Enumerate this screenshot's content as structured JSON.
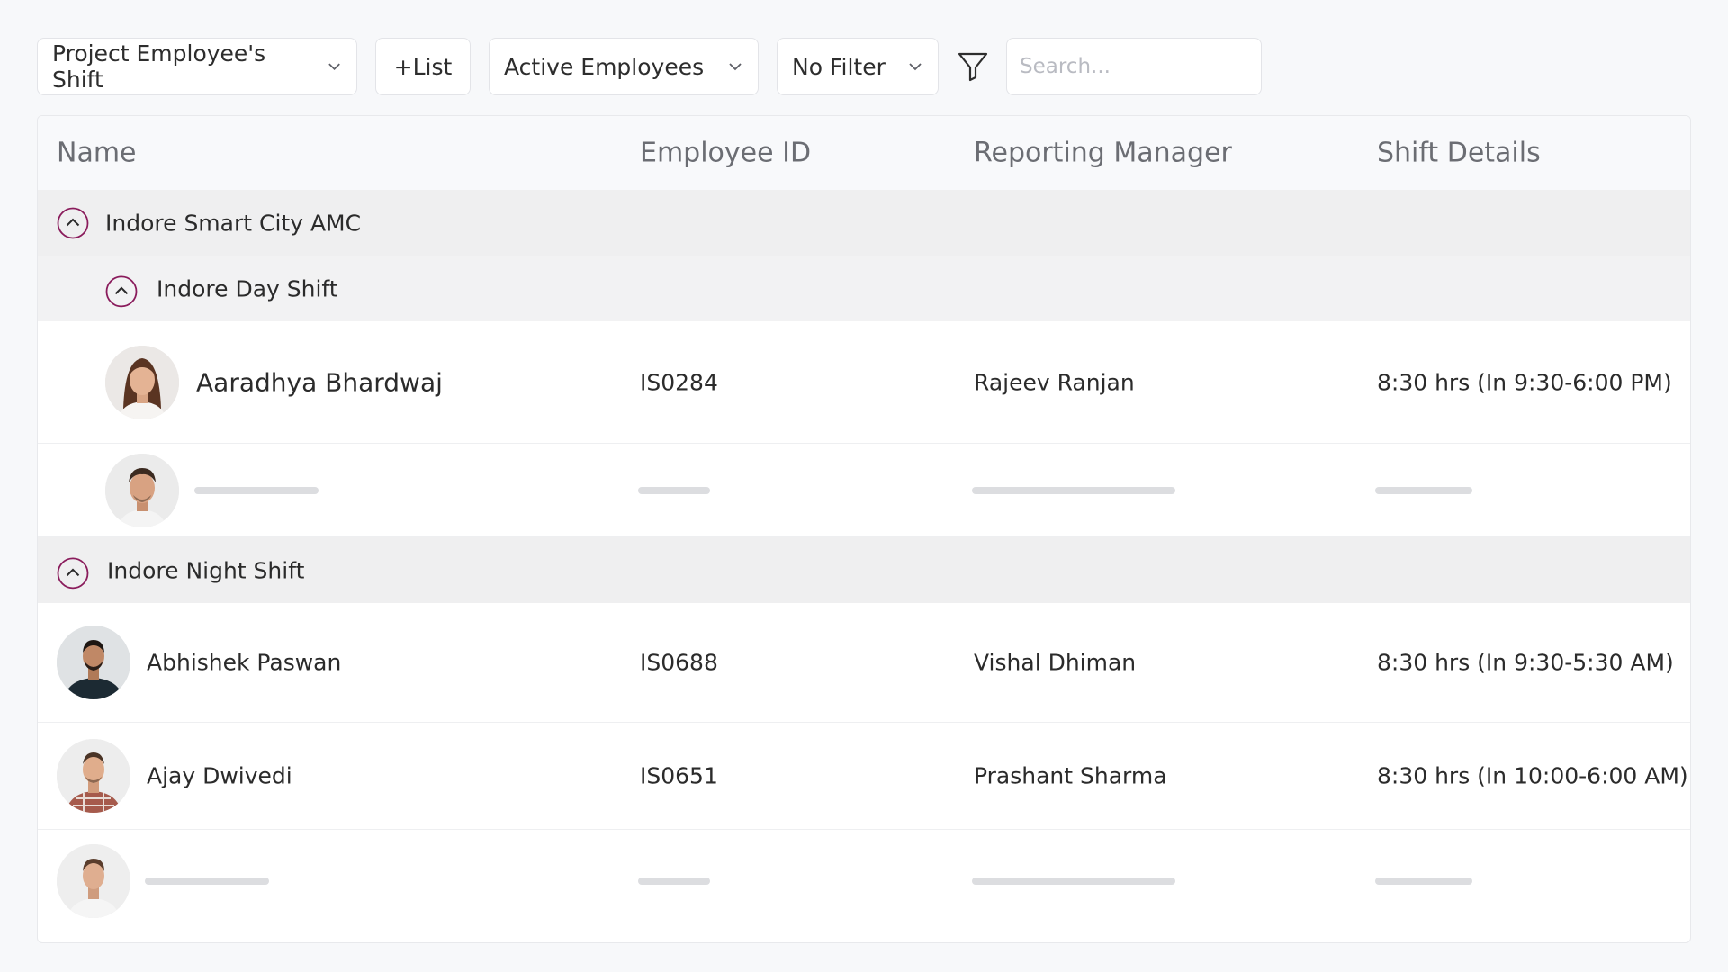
{
  "toolbar": {
    "view_select": "Project Employee's Shift",
    "list_button": "+List",
    "status_select": "Active Employees",
    "filter_select": "No Filter",
    "search_placeholder": "Search..."
  },
  "table": {
    "columns": [
      "Name",
      "Employee ID",
      "Reporting Manager",
      "Shift Details"
    ],
    "groups": [
      {
        "name": "Indore Smart City AMC",
        "subgroups": [
          {
            "name": "Indore Day Shift",
            "rows": [
              {
                "name": "Aaradhya Bhardwaj",
                "id": "IS0284",
                "manager": "Rajeev Ranjan",
                "shift": "8:30 hrs (In 9:30-6:00 PM)"
              }
            ]
          }
        ]
      },
      {
        "name": "Indore Night Shift",
        "rows": [
          {
            "name": "Abhishek Paswan",
            "id": "IS0688",
            "manager": "Vishal Dhiman",
            "shift": "8:30 hrs (In 9:30-5:30 AM)"
          },
          {
            "name": "Ajay Dwivedi",
            "id": "IS0651",
            "manager": "Prashant Sharma",
            "shift": "8:30 hrs (In 10:00-6:00 AM)"
          }
        ]
      }
    ]
  },
  "icons": {
    "dropdown": "chevron-down-icon",
    "filter": "funnel-icon",
    "group_toggle": "chevron-up-circle-icon",
    "toggle_color": "#8a1c5c"
  }
}
